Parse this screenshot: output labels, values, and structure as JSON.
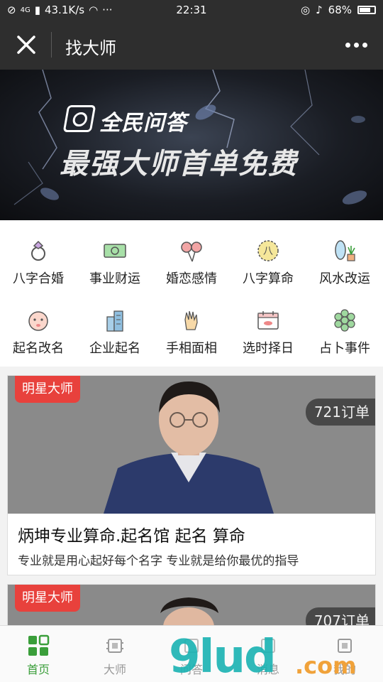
{
  "status_bar": {
    "network_speed": "43.1K/s",
    "time": "22:31",
    "battery": "68%",
    "signal": "4G"
  },
  "navbar": {
    "title": "找大师"
  },
  "banner": {
    "brand": "全民问答",
    "headline": "最强大师首单免费"
  },
  "categories": [
    {
      "label": "八字合婚",
      "icon": "ring-icon"
    },
    {
      "label": "事业财运",
      "icon": "money-icon"
    },
    {
      "label": "婚恋感情",
      "icon": "lollipop-icon"
    },
    {
      "label": "八字算命",
      "icon": "bazi-icon"
    },
    {
      "label": "风水改运",
      "icon": "mirror-plant-icon"
    },
    {
      "label": "起名改名",
      "icon": "baby-face-icon"
    },
    {
      "label": "企业起名",
      "icon": "building-icon"
    },
    {
      "label": "手相面相",
      "icon": "palm-icon"
    },
    {
      "label": "选时择日",
      "icon": "calendar-icon"
    },
    {
      "label": "占卜事件",
      "icon": "hexagon-cluster-icon"
    }
  ],
  "cards": [
    {
      "tag": "明星大师",
      "orders": "721订单",
      "title": "炳坤专业算命.起名馆 起名 算命",
      "desc": "专业就是用心起好每个名字 专业就是给你最优的指导"
    },
    {
      "tag": "明星大师",
      "orders": "707订单"
    }
  ],
  "tabs": [
    {
      "label": "首页",
      "active": true
    },
    {
      "label": "大师",
      "active": false
    },
    {
      "label": "问答",
      "active": false
    },
    {
      "label": "消息",
      "active": false
    },
    {
      "label": "我的",
      "active": false
    }
  ],
  "watermark": {
    "text": "9lud",
    "suffix": ".com"
  },
  "colors": {
    "accent_green": "#3a9e3a",
    "tag_red": "#e8413c",
    "navbar": "#2e2e2e"
  }
}
